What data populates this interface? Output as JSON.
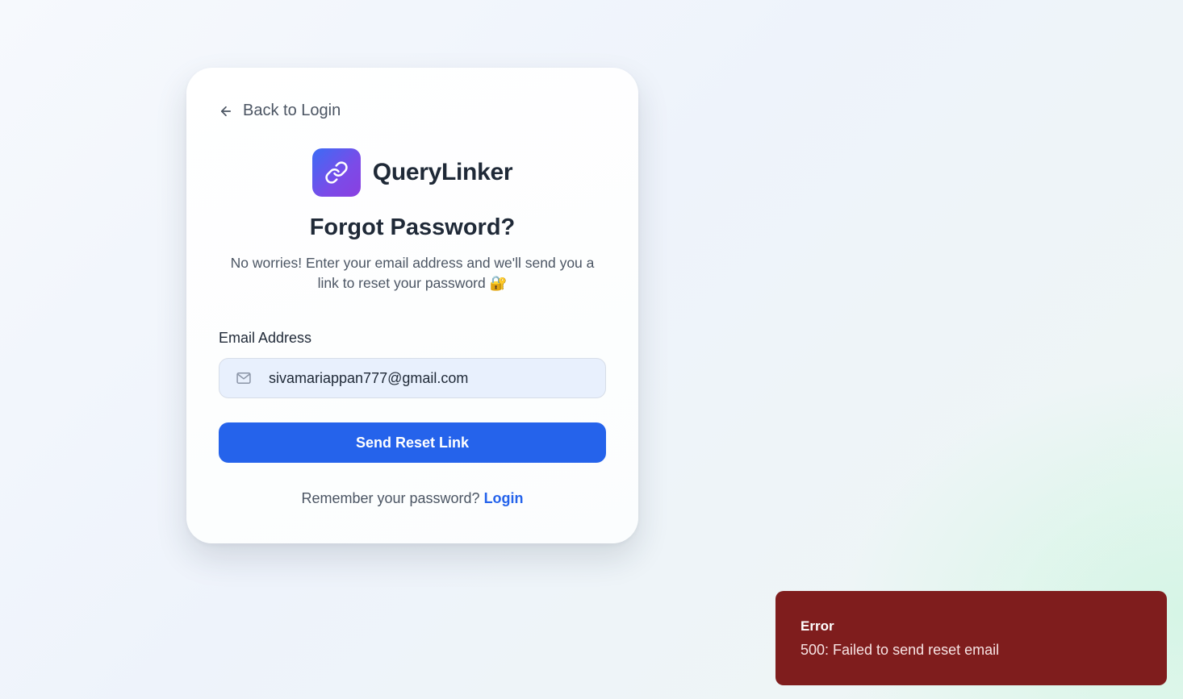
{
  "card": {
    "back_label": "Back to Login",
    "brand_name": "QueryLinker",
    "title": "Forgot Password?",
    "subtitle": "No worries! Enter your email address and we'll send you a link to reset your password 🔐",
    "email_label": "Email Address",
    "email_value": "sivamariappan777@gmail.com",
    "submit_label": "Send Reset Link",
    "footer_text": "Remember your password?",
    "footer_link": "Login"
  },
  "toast": {
    "title": "Error",
    "message": "500: Failed to send reset email"
  },
  "colors": {
    "primary": "#2563eb",
    "error_bg": "#7f1d1d",
    "logo_gradient_start": "#3b6cf5",
    "logo_gradient_end": "#8a3fe0"
  },
  "icons": {
    "back": "arrow-left-icon",
    "logo": "link-icon",
    "email": "mail-icon"
  }
}
